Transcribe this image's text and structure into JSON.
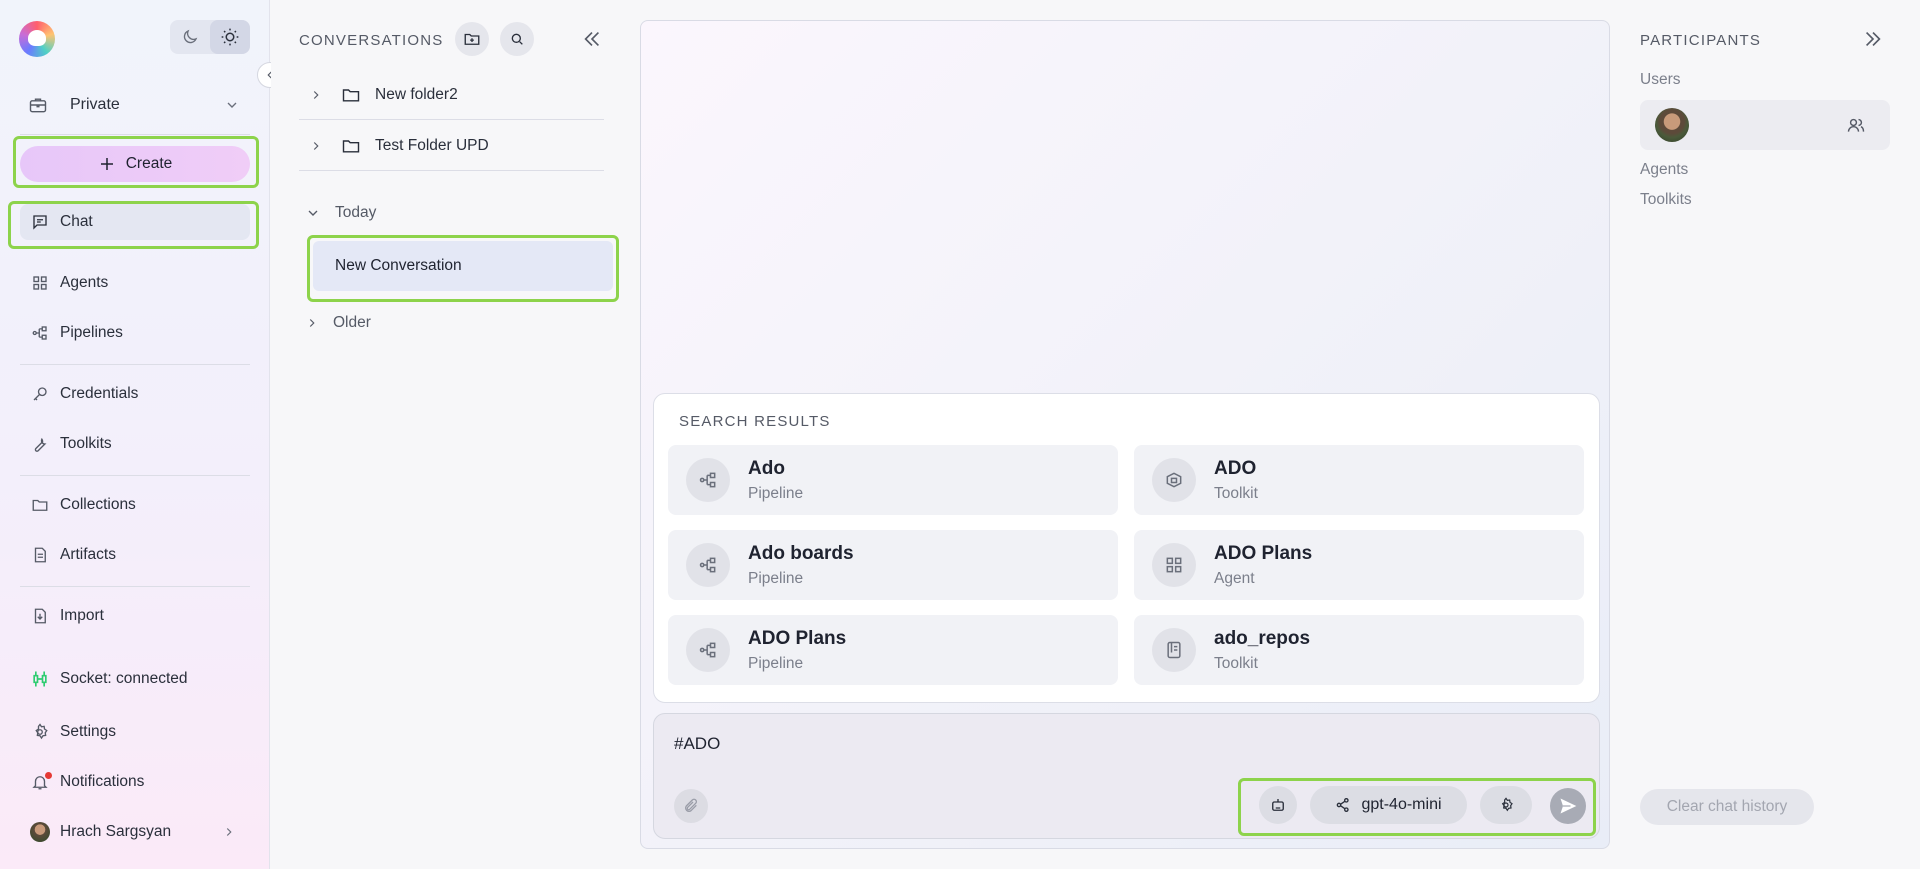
{
  "sidebar": {
    "workspace": "Private",
    "create_label": "Create",
    "nav": {
      "chat": "Chat",
      "agents": "Agents",
      "pipelines": "Pipelines",
      "credentials": "Credentials",
      "toolkits": "Toolkits",
      "collections": "Collections",
      "artifacts": "Artifacts",
      "import": "Import",
      "socket": "Socket: connected",
      "settings": "Settings",
      "notifications": "Notifications",
      "user": "Hrach Sargsyan"
    }
  },
  "conversations": {
    "title": "CONVERSATIONS",
    "folders": [
      "New folder2",
      "Test Folder UPD"
    ],
    "groups": {
      "today": "Today",
      "older": "Older"
    },
    "items": [
      "New Conversation"
    ]
  },
  "search_results": {
    "title": "SEARCH RESULTS",
    "items": [
      {
        "name": "Ado",
        "type": "Pipeline",
        "icon": "pipeline-icon"
      },
      {
        "name": "ADO",
        "type": "Toolkit",
        "icon": "toolkit-icon"
      },
      {
        "name": "Ado boards",
        "type": "Pipeline",
        "icon": "pipeline-icon"
      },
      {
        "name": "ADO Plans",
        "type": "Agent",
        "icon": "agent-icon"
      },
      {
        "name": "ADO Plans",
        "type": "Pipeline",
        "icon": "pipeline-icon"
      },
      {
        "name": "ado_repos",
        "type": "Toolkit",
        "icon": "repo-icon"
      }
    ]
  },
  "chat_input": {
    "value": "#ADO",
    "model": "gpt-4o-mini"
  },
  "participants": {
    "title": "PARTICIPANTS",
    "users": "Users",
    "agents": "Agents",
    "toolkits": "Toolkits",
    "clear_label": "Clear chat history"
  },
  "colors": {
    "highlight": "#8dd34b",
    "create_gradient": "#e7c7f9",
    "socket": "#2ecc71",
    "notification_dot": "#e53935"
  }
}
